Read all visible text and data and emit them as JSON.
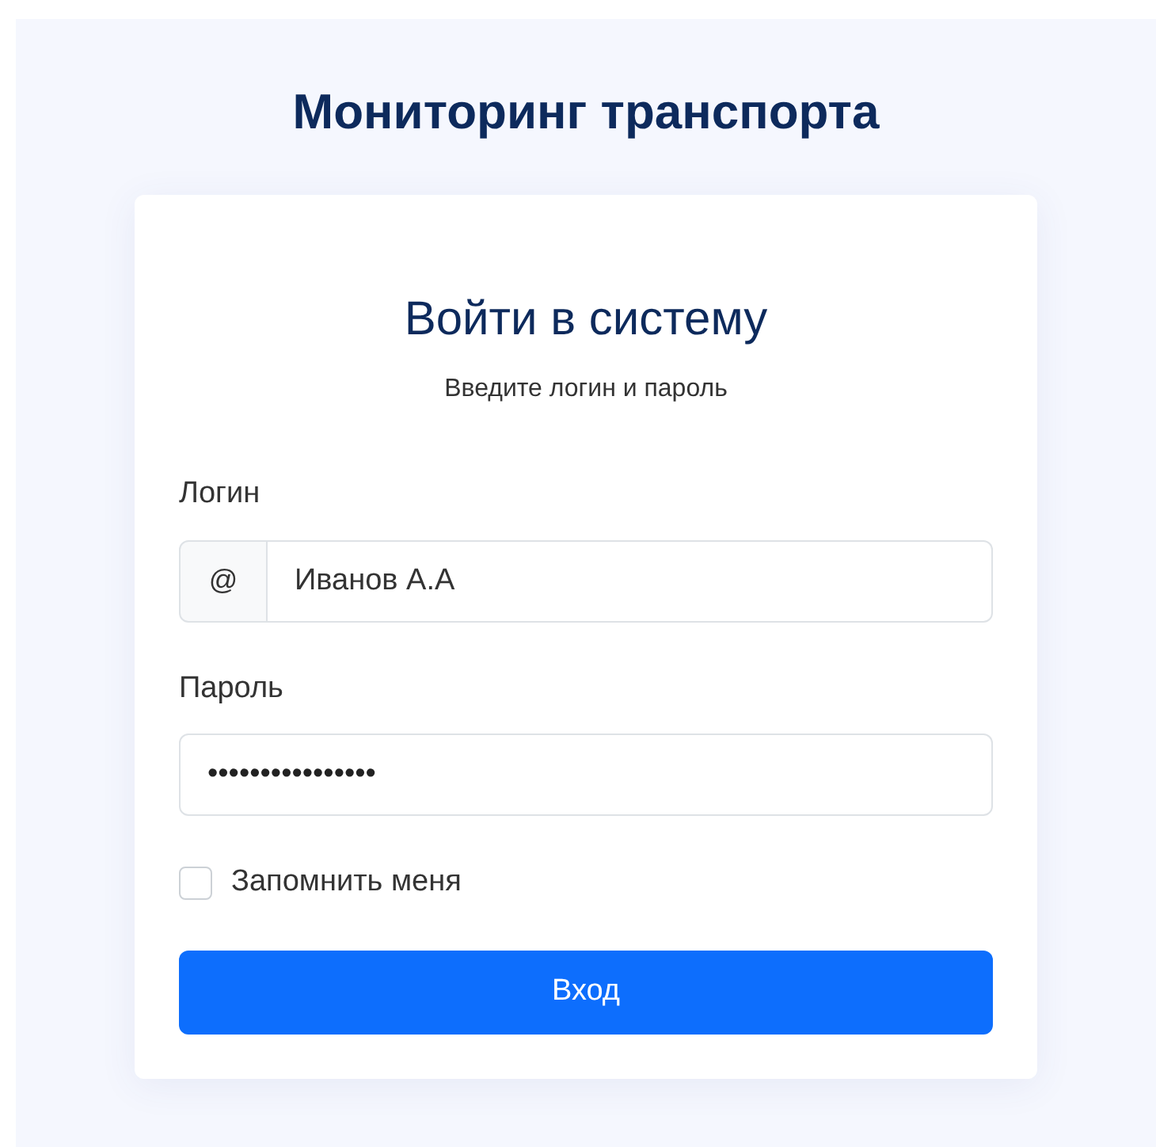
{
  "app_title": "Мониторинг транспорта",
  "card": {
    "title": "Войти в систему",
    "subtitle": "Введите логин и пароль"
  },
  "login": {
    "label": "Логин",
    "prefix": "@",
    "value": "Иванов А.А"
  },
  "password": {
    "label": "Пароль",
    "value": "••••••••••••••••"
  },
  "remember": {
    "label": "Запомнить меня",
    "checked": false
  },
  "submit": {
    "label": "Вход"
  }
}
